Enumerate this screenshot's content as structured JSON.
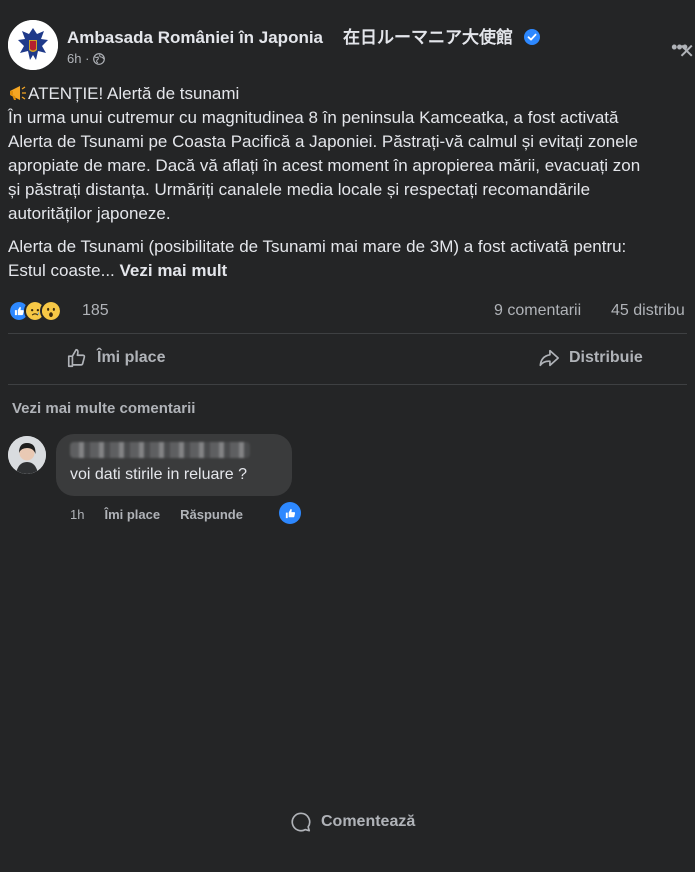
{
  "header": {
    "page_name": "Ambasada României în Japonia",
    "page_name_jp": "在日ルーマニア大使館",
    "time": "6h ·",
    "more_icon": "more-icon",
    "close_icon": "close-icon"
  },
  "post": {
    "line1": "ATENȚIE! Alertă de tsunami",
    "line2": "În urma unui cutremur cu magnitudinea 8 în peninsula Kamceatka, a fost activată",
    "line3": "Alerta de Tsunami pe Coasta Pacifică a Japoniei. Păstrați-vă calmul și evitați zonele",
    "line4": "apropiate de mare. Dacă vă aflați în acest moment în apropierea mării, evacuați zon",
    "line5": "și păstrați distanța. Urmăriți canalele media locale și respectați recomandările",
    "line6": "autorităților japoneze.",
    "line7": "Alerta de Tsunami (posibilitate de Tsunami mai mare de 3M) a fost activată pentru:",
    "line8": "Estul coaste...",
    "see_more": "Vezi mai mult"
  },
  "stats": {
    "reaction_count": "185",
    "comments": "9 comentarii",
    "shares": "45 distribu"
  },
  "actions": {
    "like": "Îmi place",
    "comment": "Comentează",
    "share": "Distribuie"
  },
  "comments_section": {
    "more_comments": "Vezi mai multe comentarii",
    "comment_text": "voi dati stirile in reluare ?",
    "time": "1h",
    "like": "Îmi place",
    "reply": "Răspunde"
  },
  "colors": {
    "background": "#242526",
    "text": "#e4e6eb",
    "secondary": "#b0b3b8",
    "like_blue": "#2d88ff"
  }
}
